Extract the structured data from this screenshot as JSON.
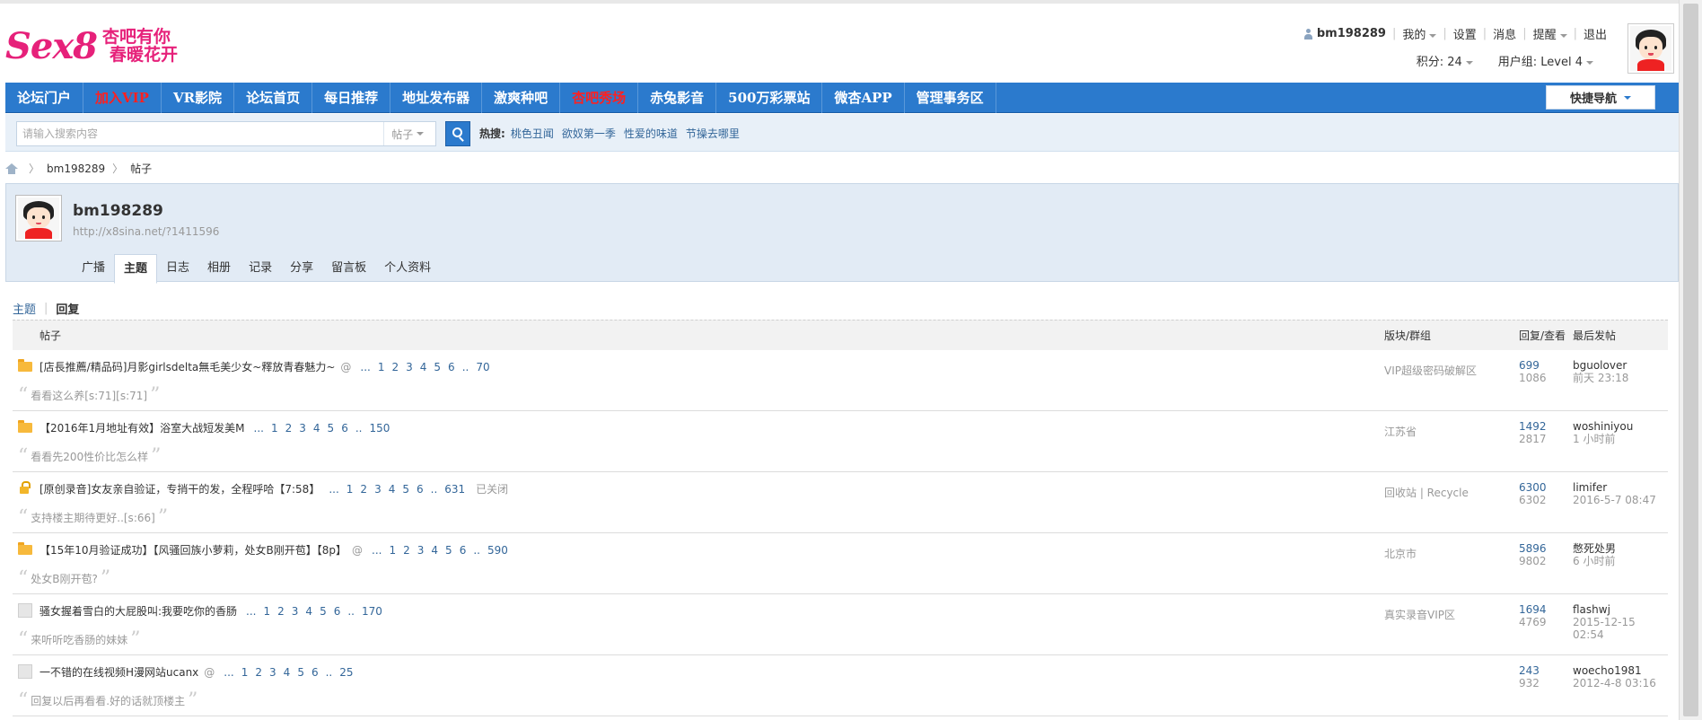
{
  "header": {
    "logo_text": "Sex8",
    "slogan_line1": "杏吧有你",
    "slogan_line2": "春暖花开",
    "username": "bm198289",
    "menu": [
      "我的",
      "设置",
      "消息",
      "提醒",
      "退出"
    ],
    "points_label": "积分: 24",
    "group_label": "用户组: Level 4"
  },
  "nav": {
    "items": [
      {
        "label": "论坛门户",
        "hot": false
      },
      {
        "label": "加入VIP",
        "hot": true
      },
      {
        "label": "VR影院",
        "hot": false
      },
      {
        "label": "论坛首页",
        "hot": false
      },
      {
        "label": "每日推荐",
        "hot": false
      },
      {
        "label": "地址发布器",
        "hot": false
      },
      {
        "label": "激爽种吧",
        "hot": false
      },
      {
        "label": "杏吧秀场",
        "hot": true
      },
      {
        "label": "赤兔影音",
        "hot": false
      },
      {
        "label": "500万彩票站",
        "hot": false
      },
      {
        "label": "微杏APP",
        "hot": false
      },
      {
        "label": "管理事务区",
        "hot": false
      }
    ],
    "quick_nav": "快捷导航"
  },
  "search": {
    "placeholder": "请输入搜索内容",
    "type": "帖子",
    "hot_label": "热搜:",
    "hot_words": [
      "桃色丑闻",
      "欲奴第一季",
      "性爱的味道",
      "节操去哪里"
    ]
  },
  "breadcrumb": {
    "user": "bm198289",
    "current": "帖子"
  },
  "profile": {
    "name": "bm198289",
    "url": "http://x8sina.net/?1411596",
    "tabs": [
      "广播",
      "主题",
      "日志",
      "相册",
      "记录",
      "分享",
      "留言板",
      "个人资料"
    ],
    "active_tab": "主题"
  },
  "subtabs": {
    "topic": "主题",
    "reply": "回复"
  },
  "table": {
    "head_title": "帖子",
    "head_forum": "版块/群组",
    "head_stats": "回复/查看",
    "head_last": "最后发帖",
    "rows": [
      {
        "icon": "folder-new",
        "title": "[店長推薦/精品码]月影girlsdelta無毛美少女~釋放青春魅力~",
        "at": "@",
        "pages": [
          "...",
          "1",
          "2",
          "3",
          "4",
          "5",
          "6",
          "..",
          "70"
        ],
        "closed": "",
        "forum": "VIP超级密码破解区",
        "replies": "699",
        "views": "1086",
        "last_user": "bguolover",
        "last_time": "前天 23:18",
        "quote": "看看这么养[s:71][s:71]"
      },
      {
        "icon": "folder-new",
        "title": "【2016年1月地址有效】浴室大战短发美M",
        "at": "",
        "pages": [
          "...",
          "1",
          "2",
          "3",
          "4",
          "5",
          "6",
          "..",
          "150"
        ],
        "closed": "",
        "forum": "江苏省",
        "replies": "1492",
        "views": "2817",
        "last_user": "woshiniyou",
        "last_time": "1 小时前",
        "quote": "看看先200性价比怎么样"
      },
      {
        "icon": "folder-lock",
        "title": "[原创录音]女友亲自验证，专捎干的发，全程呼哈【7:58】",
        "at": "",
        "pages": [
          "...",
          "1",
          "2",
          "3",
          "4",
          "5",
          "6",
          "..",
          "631"
        ],
        "closed": "已关闭",
        "forum": "回收站 | Recycle",
        "replies": "6300",
        "views": "6302",
        "last_user": "limifer",
        "last_time": "2016-5-7 08:47",
        "quote": "支持楼主期待更好..[s:66]"
      },
      {
        "icon": "folder-new",
        "title": "【15年10月验证成功】【风骚回族小萝莉，处女B刚开苞】【8p】",
        "at": "@",
        "pages": [
          "...",
          "1",
          "2",
          "3",
          "4",
          "5",
          "6",
          "..",
          "590"
        ],
        "closed": "",
        "forum": "北京市",
        "replies": "5896",
        "views": "9802",
        "last_user": "憋死处男",
        "last_time": "6 小时前",
        "quote": "处女B刚开苞?"
      },
      {
        "icon": "folder-plain",
        "title": "骚女握着雪白的大屁股叫:我要吃你的香肠",
        "at": "",
        "pages": [
          "...",
          "1",
          "2",
          "3",
          "4",
          "5",
          "6",
          "..",
          "170"
        ],
        "closed": "",
        "forum": "真实录音VIP区",
        "replies": "1694",
        "views": "4769",
        "last_user": "flashwj",
        "last_time": "2015-12-15 02:54",
        "quote": "来听听吃香肠的妹妹"
      },
      {
        "icon": "folder-plain",
        "title": "一不错的在线视频H漫网站ucanx",
        "at": "@",
        "pages": [
          "...",
          "1",
          "2",
          "3",
          "4",
          "5",
          "6",
          "..",
          "25"
        ],
        "closed": "",
        "forum": "",
        "replies": "243",
        "views": "932",
        "last_user": "woecho1981",
        "last_time": "2012-4-8 03:16",
        "quote": "回复以后再看看.好的话就顶楼主"
      }
    ]
  }
}
